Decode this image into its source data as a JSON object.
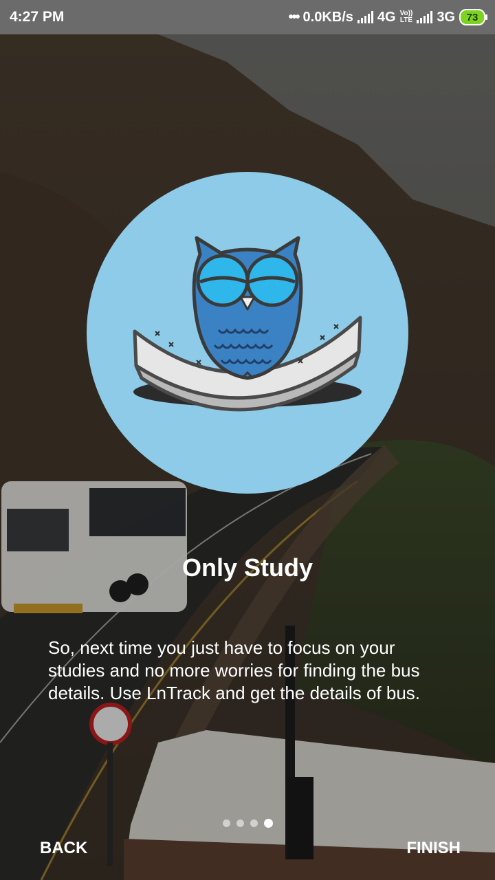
{
  "status_bar": {
    "time": "4:27 PM",
    "dots": "•••",
    "speed": "0.0KB/s",
    "network1": "4G",
    "volte_top": "Vo))",
    "volte_bottom": "LTE",
    "network2": "3G",
    "battery": "73",
    "battery_color": "#7ed321"
  },
  "onboarding": {
    "illustration": "sleeping-owl-icon",
    "circle_color": "#8dcbe8",
    "title": "Only Study",
    "description": "So, next time you just have to focus on your studies and no more worries for finding the bus details. Use LnTrack and get the details of bus.",
    "page_count": 4,
    "active_page": 4
  },
  "nav": {
    "back_label": "BACK",
    "finish_label": "FINISH"
  }
}
